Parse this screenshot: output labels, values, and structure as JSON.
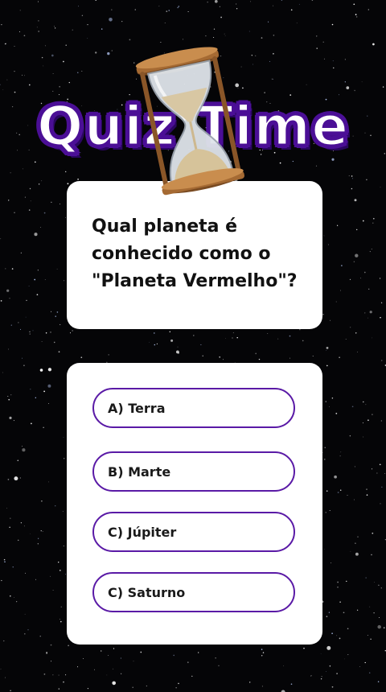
{
  "title": "Quiz Time",
  "question": "Qual planeta é conhecido como o \"Planeta Vermelho\"?",
  "options": [
    {
      "label": "A) Terra"
    },
    {
      "label": "B) Marte"
    },
    {
      "label": "C) Júpiter"
    },
    {
      "label": "C) Saturno"
    }
  ],
  "colors": {
    "background": "#050507",
    "title_outline": "#4b0f96",
    "option_border": "#5a1aa6",
    "card": "#ffffff"
  },
  "icons": [
    "hourglass-icon"
  ]
}
